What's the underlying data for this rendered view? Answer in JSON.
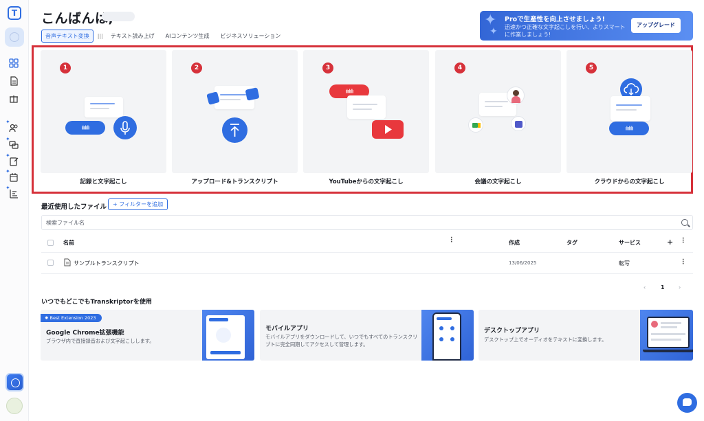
{
  "header": {
    "greeting": "こんばんは,",
    "tabs": [
      "音声テキスト変換",
      "テキスト読み上げ",
      "AIコンテンツ生成",
      "ビジネスソリューション"
    ],
    "active_tab": 0
  },
  "promo": {
    "title": "Proで生産性を向上させましょう!",
    "subtitle": "迅速かつ正確な文字起こしを行い、よりスマートに作業しましょう!",
    "button": "アップグレード"
  },
  "cards": [
    {
      "number": "1",
      "label": "記録と文字起こし"
    },
    {
      "number": "2",
      "label": "アップロード&トランスクリプト"
    },
    {
      "number": "3",
      "label": "YouTubeからの文字起こし"
    },
    {
      "number": "4",
      "label": "会議の文字起こし"
    },
    {
      "number": "5",
      "label": "クラウドからの文字起こし"
    }
  ],
  "recent": {
    "title": "最近使用したファイル",
    "filter_button": "+ フィルターを追加",
    "search_placeholder": "検索ファイル名",
    "columns": {
      "name": "名前",
      "created": "作成",
      "tags": "タグ",
      "service": "サービス"
    },
    "add": "+",
    "rows": [
      {
        "name": "サンプルトランスクリプト",
        "created": "13/06/2025",
        "service": "転写"
      }
    ],
    "pager": {
      "prev": "‹",
      "page": "1",
      "next": "›"
    }
  },
  "anywhere": {
    "title": "いつでもどこでもTranskriptorを使用",
    "items": [
      {
        "badge": "Best Extension 2023",
        "title": "Google Chrome拡張機能",
        "desc": "ブラウザ内で直接録音および文字起こしします。"
      },
      {
        "title": "モバイルアプリ",
        "desc": "モバイルアプリをダウンロードして、いつでもすべてのトランスクリプトに完全同期してアクセスして管理します。"
      },
      {
        "title": "デスクトップアプリ",
        "desc": "デスクトップ上でオーディオをテキストに変換します。"
      }
    ]
  },
  "colors": {
    "accent": "#2f6de1",
    "highlight": "#d6313a"
  }
}
